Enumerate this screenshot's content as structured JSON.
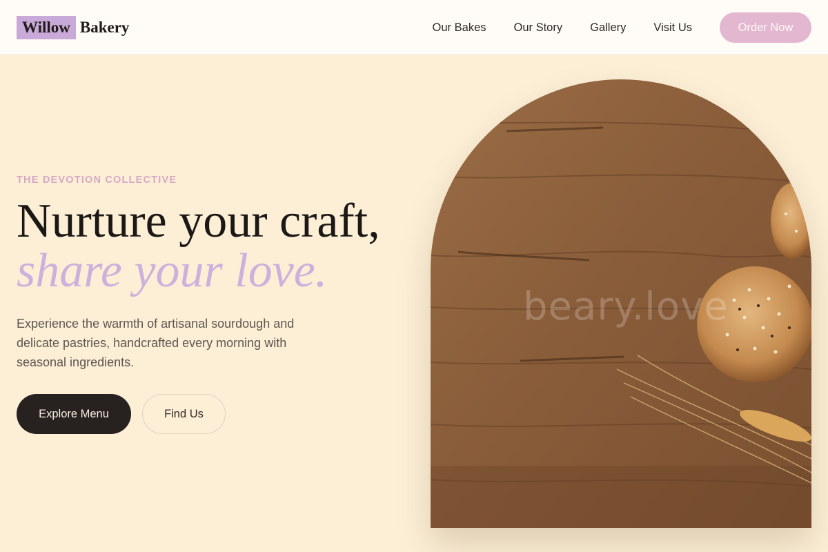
{
  "header": {
    "logo_highlight": "Willow",
    "logo_rest": "Bakery",
    "nav": [
      "Our Bakes",
      "Our Story",
      "Gallery",
      "Visit Us"
    ],
    "cta": "Order Now"
  },
  "hero": {
    "eyebrow": "THE DEVOTION COLLECTIVE",
    "headline_line1": "Nurture your craft,",
    "headline_line2": "share your love.",
    "lead": "Experience the warmth of artisanal sourdough and delicate pastries, handcrafted every morning with seasonal ingredients.",
    "primary_button": "Explore Menu",
    "secondary_button": "Find Us",
    "image_watermark": "beary.love",
    "image_icon": "bread-on-wood-image"
  },
  "colors": {
    "background": "#fcefd6",
    "header_bg": "#fffbf6",
    "accent_lilac": "#cdb1dd",
    "accent_pink": "#e3b7d0",
    "dark": "#27211f"
  }
}
